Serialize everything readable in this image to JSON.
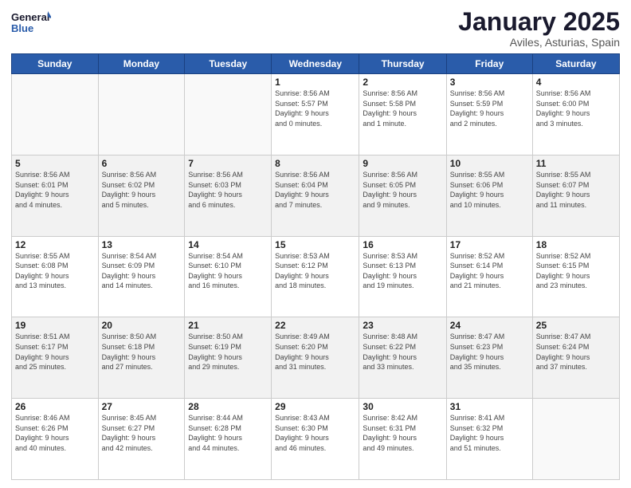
{
  "logo": {
    "general": "General",
    "blue": "Blue"
  },
  "header": {
    "month": "January 2025",
    "location": "Aviles, Asturias, Spain"
  },
  "weekdays": [
    "Sunday",
    "Monday",
    "Tuesday",
    "Wednesday",
    "Thursday",
    "Friday",
    "Saturday"
  ],
  "weeks": [
    [
      {
        "day": "",
        "info": ""
      },
      {
        "day": "",
        "info": ""
      },
      {
        "day": "",
        "info": ""
      },
      {
        "day": "1",
        "info": "Sunrise: 8:56 AM\nSunset: 5:57 PM\nDaylight: 9 hours\nand 0 minutes."
      },
      {
        "day": "2",
        "info": "Sunrise: 8:56 AM\nSunset: 5:58 PM\nDaylight: 9 hours\nand 1 minute."
      },
      {
        "day": "3",
        "info": "Sunrise: 8:56 AM\nSunset: 5:59 PM\nDaylight: 9 hours\nand 2 minutes."
      },
      {
        "day": "4",
        "info": "Sunrise: 8:56 AM\nSunset: 6:00 PM\nDaylight: 9 hours\nand 3 minutes."
      }
    ],
    [
      {
        "day": "5",
        "info": "Sunrise: 8:56 AM\nSunset: 6:01 PM\nDaylight: 9 hours\nand 4 minutes."
      },
      {
        "day": "6",
        "info": "Sunrise: 8:56 AM\nSunset: 6:02 PM\nDaylight: 9 hours\nand 5 minutes."
      },
      {
        "day": "7",
        "info": "Sunrise: 8:56 AM\nSunset: 6:03 PM\nDaylight: 9 hours\nand 6 minutes."
      },
      {
        "day": "8",
        "info": "Sunrise: 8:56 AM\nSunset: 6:04 PM\nDaylight: 9 hours\nand 7 minutes."
      },
      {
        "day": "9",
        "info": "Sunrise: 8:56 AM\nSunset: 6:05 PM\nDaylight: 9 hours\nand 9 minutes."
      },
      {
        "day": "10",
        "info": "Sunrise: 8:55 AM\nSunset: 6:06 PM\nDaylight: 9 hours\nand 10 minutes."
      },
      {
        "day": "11",
        "info": "Sunrise: 8:55 AM\nSunset: 6:07 PM\nDaylight: 9 hours\nand 11 minutes."
      }
    ],
    [
      {
        "day": "12",
        "info": "Sunrise: 8:55 AM\nSunset: 6:08 PM\nDaylight: 9 hours\nand 13 minutes."
      },
      {
        "day": "13",
        "info": "Sunrise: 8:54 AM\nSunset: 6:09 PM\nDaylight: 9 hours\nand 14 minutes."
      },
      {
        "day": "14",
        "info": "Sunrise: 8:54 AM\nSunset: 6:10 PM\nDaylight: 9 hours\nand 16 minutes."
      },
      {
        "day": "15",
        "info": "Sunrise: 8:53 AM\nSunset: 6:12 PM\nDaylight: 9 hours\nand 18 minutes."
      },
      {
        "day": "16",
        "info": "Sunrise: 8:53 AM\nSunset: 6:13 PM\nDaylight: 9 hours\nand 19 minutes."
      },
      {
        "day": "17",
        "info": "Sunrise: 8:52 AM\nSunset: 6:14 PM\nDaylight: 9 hours\nand 21 minutes."
      },
      {
        "day": "18",
        "info": "Sunrise: 8:52 AM\nSunset: 6:15 PM\nDaylight: 9 hours\nand 23 minutes."
      }
    ],
    [
      {
        "day": "19",
        "info": "Sunrise: 8:51 AM\nSunset: 6:17 PM\nDaylight: 9 hours\nand 25 minutes."
      },
      {
        "day": "20",
        "info": "Sunrise: 8:50 AM\nSunset: 6:18 PM\nDaylight: 9 hours\nand 27 minutes."
      },
      {
        "day": "21",
        "info": "Sunrise: 8:50 AM\nSunset: 6:19 PM\nDaylight: 9 hours\nand 29 minutes."
      },
      {
        "day": "22",
        "info": "Sunrise: 8:49 AM\nSunset: 6:20 PM\nDaylight: 9 hours\nand 31 minutes."
      },
      {
        "day": "23",
        "info": "Sunrise: 8:48 AM\nSunset: 6:22 PM\nDaylight: 9 hours\nand 33 minutes."
      },
      {
        "day": "24",
        "info": "Sunrise: 8:47 AM\nSunset: 6:23 PM\nDaylight: 9 hours\nand 35 minutes."
      },
      {
        "day": "25",
        "info": "Sunrise: 8:47 AM\nSunset: 6:24 PM\nDaylight: 9 hours\nand 37 minutes."
      }
    ],
    [
      {
        "day": "26",
        "info": "Sunrise: 8:46 AM\nSunset: 6:26 PM\nDaylight: 9 hours\nand 40 minutes."
      },
      {
        "day": "27",
        "info": "Sunrise: 8:45 AM\nSunset: 6:27 PM\nDaylight: 9 hours\nand 42 minutes."
      },
      {
        "day": "28",
        "info": "Sunrise: 8:44 AM\nSunset: 6:28 PM\nDaylight: 9 hours\nand 44 minutes."
      },
      {
        "day": "29",
        "info": "Sunrise: 8:43 AM\nSunset: 6:30 PM\nDaylight: 9 hours\nand 46 minutes."
      },
      {
        "day": "30",
        "info": "Sunrise: 8:42 AM\nSunset: 6:31 PM\nDaylight: 9 hours\nand 49 minutes."
      },
      {
        "day": "31",
        "info": "Sunrise: 8:41 AM\nSunset: 6:32 PM\nDaylight: 9 hours\nand 51 minutes."
      },
      {
        "day": "",
        "info": ""
      }
    ]
  ]
}
